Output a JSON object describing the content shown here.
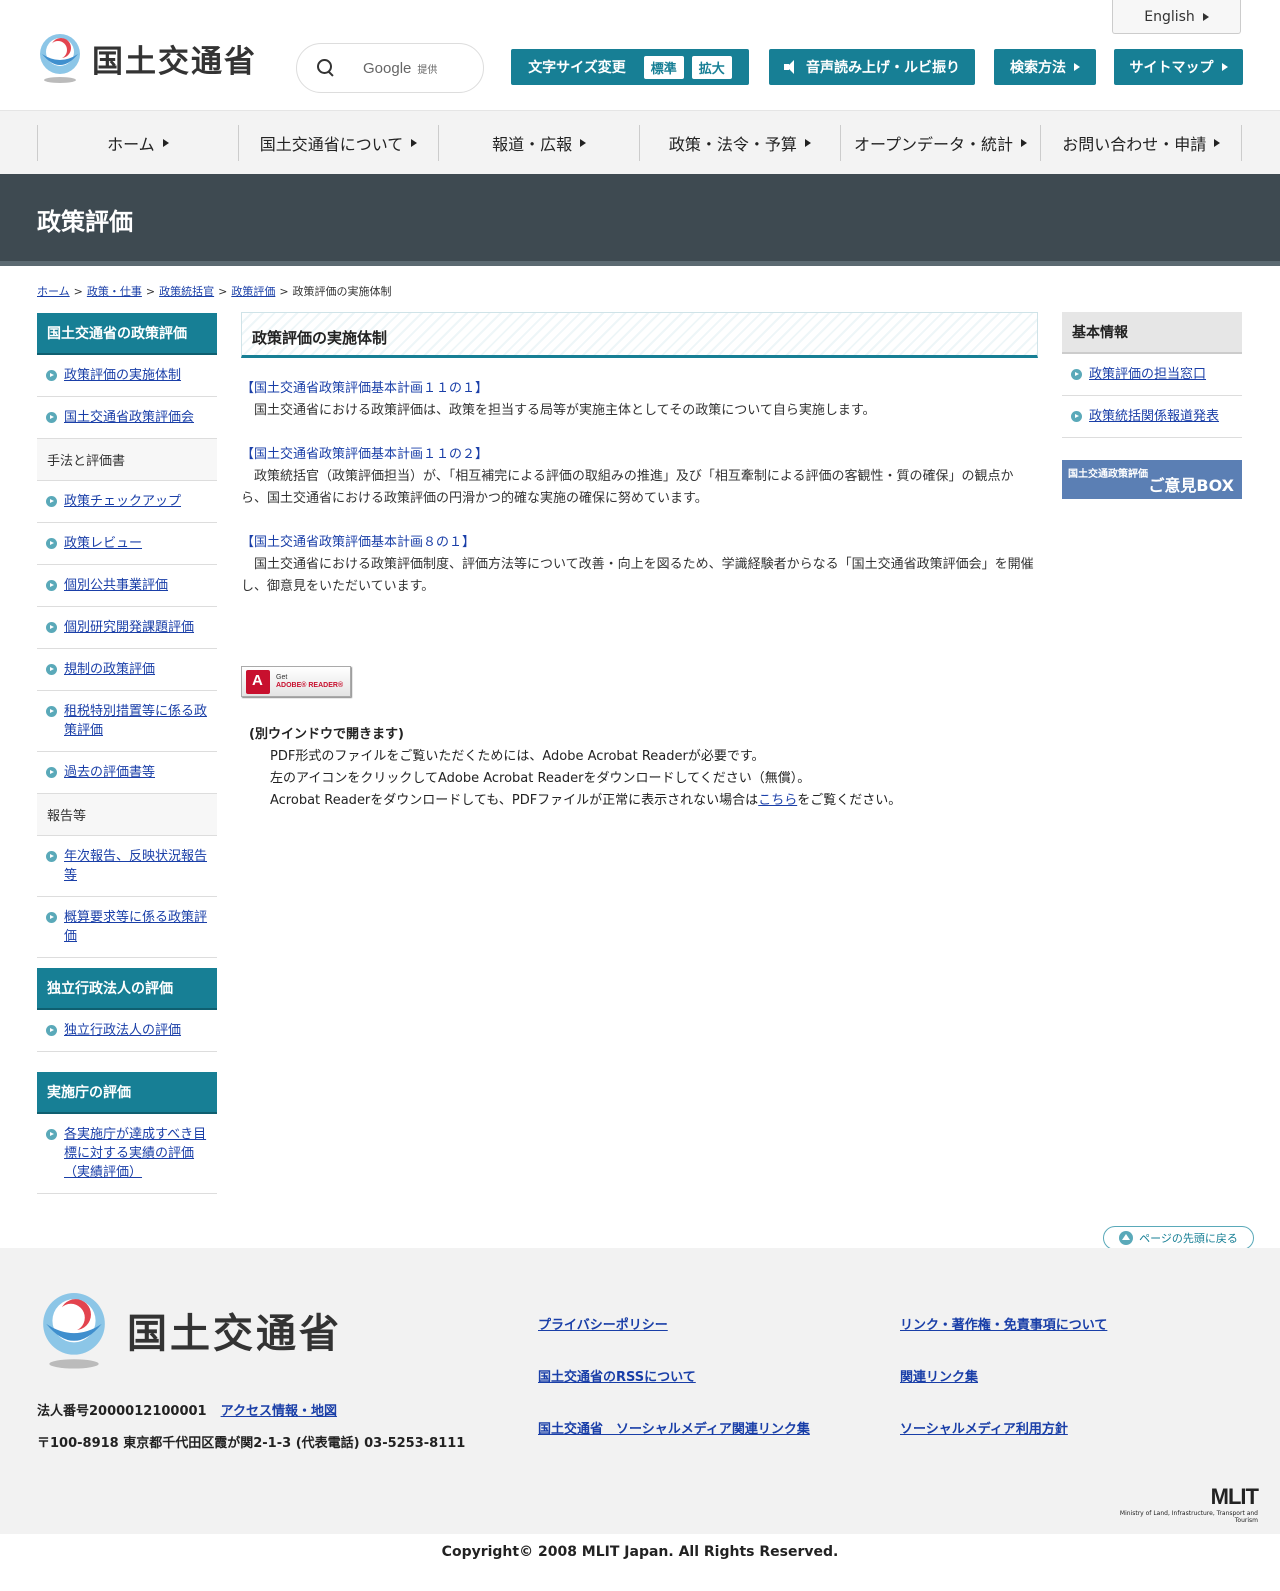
{
  "header": {
    "site_name": "国土交通省",
    "english_label": "English",
    "search_brand": "Google",
    "search_brand_sub": "提供",
    "font_size_label": "文字サイズ変更",
    "font_size_standard": "標準",
    "font_size_large": "拡大",
    "speech_label": "音声読み上げ・ルビ振り",
    "search_method_label": "検索方法",
    "sitemap_label": "サイトマップ"
  },
  "gnav": {
    "items": [
      {
        "label": "ホーム"
      },
      {
        "label": "国土交通省について"
      },
      {
        "label": "報道・広報"
      },
      {
        "label": "政策・法令・予算"
      },
      {
        "label": "オープンデータ・統計"
      },
      {
        "label": "お問い合わせ・申請"
      }
    ]
  },
  "page_title": "政策評価",
  "breadcrumb": {
    "items": [
      "ホーム",
      "政策・仕事",
      "政策統括官",
      "政策評価"
    ],
    "current": "政策評価の実施体制",
    "separator": ">"
  },
  "left_sidebar": {
    "section1_title": "国土交通省の政策評価",
    "section1_items": [
      "政策評価の実施体制",
      "国土交通省政策評価会"
    ],
    "group1_label": "手法と評価書",
    "group1_items": [
      "政策チェックアップ",
      "政策レビュー",
      "個別公共事業評価",
      "個別研究開発課題評価",
      "規制の政策評価",
      "租税特別措置等に係る政策評価",
      "過去の評価書等"
    ],
    "group2_label": "報告等",
    "group2_items": [
      "年次報告、反映状況報告等",
      "概算要求等に係る政策評価"
    ],
    "section2_title": "独立行政法人の評価",
    "section2_items": [
      "独立行政法人の評価"
    ],
    "section3_title": "実施庁の評価",
    "section3_items": [
      "各実施庁が達成すべき目標に対する実績の評価（実績評価）"
    ]
  },
  "main": {
    "heading": "政策評価の実施体制",
    "blocks": [
      {
        "title": "【国土交通省政策評価基本計画１１の１】",
        "text": "国土交通省における政策評価は、政策を担当する局等が実施主体としてその政策について自ら実施します。"
      },
      {
        "title": "【国土交通省政策評価基本計画１１の２】",
        "text": "政策統括官（政策評価担当）が、「相互補完による評価の取組みの推進」及び「相互牽制による評価の客観性・質の確保」の観点から、国土交通省における政策評価の円滑かつ的確な実施の確保に努めています。"
      },
      {
        "title": "【国土交通省政策評価基本計画８の１】",
        "text": "国土交通省における政策評価制度、評価方法等について改善・向上を図るため、学識経験者からなる「国土交通省政策評価会」を開催し、御意見をいただいています。"
      }
    ],
    "adobe_get": "Get",
    "adobe_reader": "ADOBE® READER®",
    "pdf_note_title": "(別ウインドウで開きます)",
    "pdf_note_line1": "PDF形式のファイルをご覧いただくためには、Adobe Acrobat Readerが必要です。",
    "pdf_note_line2": "左のアイコンをクリックしてAdobe Acrobat Readerをダウンロードしてください（無償）。",
    "pdf_note_line3_pre": "Acrobat Readerをダウンロードしても、PDFファイルが正常に表示されない場合は",
    "pdf_note_line3_link": "こちら",
    "pdf_note_line3_post": "をご覧ください。"
  },
  "right_sidebar": {
    "title": "基本情報",
    "items": [
      "政策評価の担当窓口",
      "政策統括関係報道発表"
    ],
    "opinion_small": "国土交通政策評価",
    "opinion_big": "ご意見BOX"
  },
  "pagetop_label": "ページの先頭に戻る",
  "footer": {
    "site_name": "国土交通省",
    "corp_number": "法人番号2000012100001",
    "access_link": "アクセス情報・地図",
    "address": "〒100-8918 東京都千代田区霞が関2-1-3 (代表電話) 03-5253-8111",
    "links": [
      "プライバシーポリシー",
      "リンク・著作権・免責事項について",
      "国土交通省のRSSについて",
      "関連リンク集",
      "国土交通省　ソーシャルメディア関連リンク集",
      "ソーシャルメディア利用方針"
    ],
    "mlit_logo": "MLIT",
    "mlit_sub": "Ministry of Land, Infrastructure, Transport and Tourism",
    "copyright": "Copyright© 2008 MLIT Japan. All Rights Reserved."
  },
  "colors": {
    "accent": "#177f95",
    "title_band": "#3e4a51",
    "link": "#1a3fa8",
    "opinion_box": "#5b7fb4"
  }
}
